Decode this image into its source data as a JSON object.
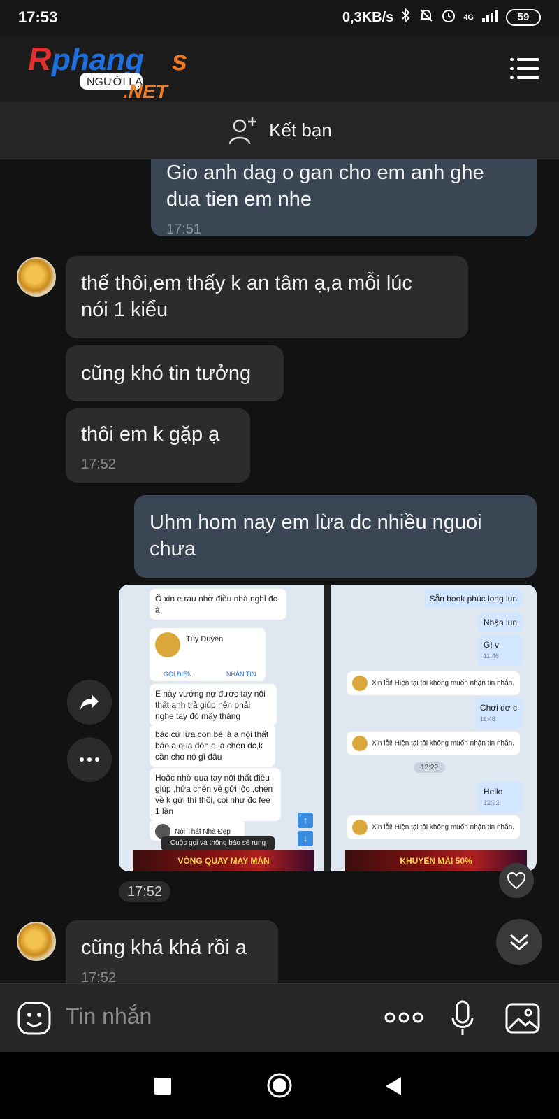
{
  "status_bar": {
    "time": "17:53",
    "speed": "0,3KB/s",
    "network": "4G",
    "battery": "59"
  },
  "app": {
    "logo_text": "Phang",
    "logo_sub": "NGƯỜI LẠ",
    "logo_domain": ".NET"
  },
  "friend_bar": {
    "label": "Kết bạn"
  },
  "messages": [
    {
      "dir": "out",
      "lines": [
        "Gio anh dag o gan cho em anh ghe",
        "dua tien em nhe"
      ],
      "time": "17:51"
    },
    {
      "dir": "in",
      "lines": [
        "thế thôi,em thấy k an tâm ạ,a mỗi lúc",
        "nói 1 kiểu"
      ],
      "time": ""
    },
    {
      "dir": "in",
      "lines": [
        "cũng khó tin tưởng"
      ],
      "time": ""
    },
    {
      "dir": "in",
      "lines": [
        "thôi em k gặp ạ"
      ],
      "time": "17:52"
    },
    {
      "dir": "out",
      "lines": [
        "Uhm hom nay em lừa dc nhiều nguoi",
        "chưa"
      ],
      "time": ""
    },
    {
      "dir": "in",
      "lines": [
        "cũng khá khá rồi a"
      ],
      "time": "17:52"
    }
  ],
  "image_message": {
    "time": "17:52",
    "left_shot": {
      "msg1": "Ô xin e rau nhờ điều nhà nghỉ đc à",
      "contact_name": "Tùy Duyên",
      "call": "GỌI ĐIỆN",
      "message": "NHẮN TIN",
      "msg2": "E này vướng nợ được tay nội thất anh trả giúp nên phải nghe tay đó mấy tháng",
      "msg3": "bác cứ lừa con bé là a nội thất báo a qua đón e là chén đc,k cần cho nó gì đâu",
      "msg4": "Hoặc nhờ qua tay nôi thất điều giúp ,hứa chén về gửi lộc ,chén về k gửi thì thôi, coi như đc fee 1 lần",
      "contact2": "Nội Thất Nhà Đẹp",
      "notice": "Cuộc gọi và thông báo sẽ rung",
      "banner": "VÒNG QUAY MAY MẮN"
    },
    "right_shot": {
      "m1": "Sẵn book phúc long lun",
      "m2": "Nhận lun",
      "m3": "Gì v",
      "m3_time": "11:46",
      "auto_reply": "Xin lỗi! Hiện tại tôi không muốn nhận tin nhắn.",
      "m4": "Chơi dơ c",
      "m4_time": "11:48",
      "divider_time": "12:22",
      "m5": "Hello",
      "m5_time": "12:22",
      "banner": "KHUYẾN MÃI 50%"
    }
  },
  "input": {
    "placeholder": "Tin nhắn",
    "more": "ooo"
  },
  "colors": {
    "background": "#121212",
    "outgoing_bubble": "#3a4654",
    "incoming_bubble": "#2c2c2c"
  }
}
